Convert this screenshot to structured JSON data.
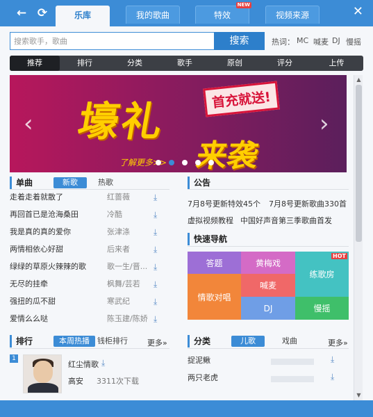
{
  "nav": {
    "back_icon": "←",
    "refresh_icon": "⟳",
    "close_icon": "✕"
  },
  "tabs": [
    {
      "label": "乐库",
      "active": true
    },
    {
      "label": "我的歌曲",
      "active": false
    },
    {
      "label": "特效",
      "active": false,
      "badge": "NEW"
    },
    {
      "label": "视频来源",
      "active": false
    }
  ],
  "search": {
    "placeholder": "搜索歌手，歌曲",
    "button": "搜索",
    "hot_label": "热词：",
    "hot_words": [
      "MC",
      "喊麦",
      "DJ",
      "慢摇"
    ]
  },
  "categories": [
    "推荐",
    "排行",
    "分类",
    "歌手",
    "原创",
    "评分",
    "上传"
  ],
  "banner": {
    "title": "壕礼",
    "subtitle": "来袭",
    "badge": "首充就送!",
    "more": "了解更多>>"
  },
  "singles": {
    "title": "单曲",
    "tabs": [
      "新歌",
      "热歌"
    ],
    "songs": [
      {
        "title": "走着走着就散了",
        "artist": "红蔷薇"
      },
      {
        "title": "再回首已是沧海桑田",
        "artist": "冷酷"
      },
      {
        "title": "我是真的真的爱你",
        "artist": "张津涤"
      },
      {
        "title": "两情相依心好甜",
        "artist": "后来者"
      },
      {
        "title": "绿绿的草原火辣辣的歌",
        "artist": "歌一生/晋..."
      },
      {
        "title": "无尽的挂牵",
        "artist": "枫舞/芸若"
      },
      {
        "title": "强扭的瓜不甜",
        "artist": "寒武纪"
      },
      {
        "title": "爱情么么哒",
        "artist": "陈玉建/陈娇"
      }
    ]
  },
  "notices": {
    "title": "公告",
    "items": [
      "7月8号更新特效45个",
      "7月8号更新歌曲330首",
      "虚拟视频教程",
      "中国好声音第三季歌曲首发"
    ]
  },
  "quicknav": {
    "title": "快速导航",
    "items": [
      "答题",
      "黄梅戏",
      "练歌房",
      "情歌对唱",
      "喊麦",
      "DJ",
      "慢摇"
    ],
    "hot_badge": "HOT"
  },
  "ranking": {
    "title": "排行",
    "tabs": [
      "本周热播",
      "钱柜排行"
    ],
    "more": "更多»",
    "top": {
      "rank": "1",
      "song": "红尘情歌",
      "artist": "高安",
      "downloads": "3311次下载"
    }
  },
  "category_list": {
    "title": "分类",
    "tabs": [
      "儿歌",
      "戏曲"
    ],
    "more": "更多»",
    "items": [
      "捉泥鳅",
      "两只老虎"
    ]
  },
  "colors": {
    "accent": "#3c8cd6",
    "dark_bar": "#3c3f45",
    "banner_gold": "#ffcf00"
  }
}
